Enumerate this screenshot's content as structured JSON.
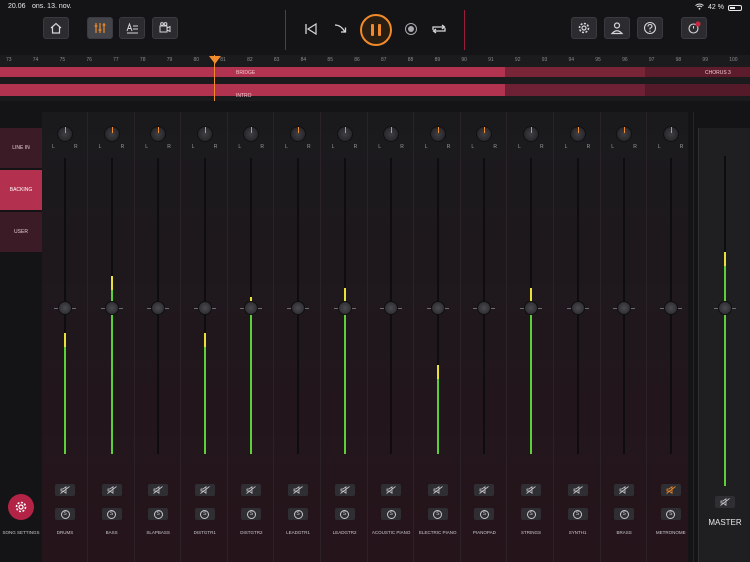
{
  "status": {
    "time": "20.06",
    "date": "ons. 13. nov.",
    "battery": "42 %"
  },
  "timeline": {
    "ruler": [
      "73",
      "74",
      "75",
      "76",
      "77",
      "78",
      "79",
      "80",
      "81",
      "82",
      "83",
      "84",
      "85",
      "86",
      "87",
      "88",
      "89",
      "90",
      "91",
      "92",
      "93",
      "94",
      "95",
      "96",
      "97",
      "98",
      "99",
      "100"
    ],
    "sections": {
      "bridge": "BRIDGE",
      "chorus": "CHORUS 3",
      "lower": "INTRO"
    }
  },
  "groups": {
    "line_in": "LINE IN",
    "backing": "BACKING",
    "user": "USER"
  },
  "song_settings": "SONG SETTINGS",
  "lr": {
    "l": "L",
    "r": "R"
  },
  "solo_letter": "S",
  "channels": [
    {
      "name": "DRUMS",
      "level": 0.41
    },
    {
      "name": "BASS",
      "level": 0.6
    },
    {
      "name": "SLAPBASS",
      "level": 0
    },
    {
      "name": "DISTGTR1",
      "level": 0.41
    },
    {
      "name": "DISTGTR2",
      "level": 0.53
    },
    {
      "name": "LEADGTR1",
      "level": 0
    },
    {
      "name": "LEADGTR2",
      "level": 0.56
    },
    {
      "name": "ACOUSTIC PIANO",
      "level": 0
    },
    {
      "name": "ELECTRIC PIANO",
      "level": 0.3
    },
    {
      "name": "PIANOPAD",
      "level": 0
    },
    {
      "name": "STRINGS",
      "level": 0.56
    },
    {
      "name": "SYNTH1",
      "level": 0
    },
    {
      "name": "BRASS",
      "level": 0
    },
    {
      "name": "METRONOME",
      "level": 0
    }
  ],
  "master": {
    "name": "MASTER",
    "level": 0.71
  },
  "colors": {
    "accent": "#f08a2a",
    "brand": "#b3304f",
    "meter": "#5dcf3a",
    "peak": "#e8e03a"
  }
}
